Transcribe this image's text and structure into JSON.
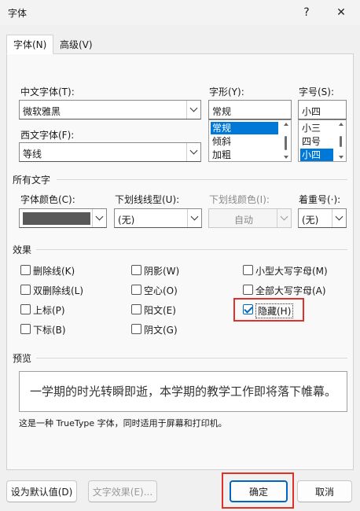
{
  "window": {
    "title": "字体",
    "help_icon": "?",
    "close_icon": "✕"
  },
  "tabs": [
    {
      "label": "字体(N)",
      "active": true
    },
    {
      "label": "高级(V)",
      "active": false
    }
  ],
  "fonts": {
    "chinese_label": "中文字体(T):",
    "chinese_value": "微软雅黑",
    "western_label": "西文字体(F):",
    "western_value": "等线",
    "style_label": "字形(Y):",
    "style_value": "常规",
    "style_options": [
      "常规",
      "倾斜",
      "加粗"
    ],
    "size_label": "字号(S):",
    "size_value": "小四",
    "size_options": [
      "小三",
      "四号",
      "小四"
    ]
  },
  "all_text": {
    "section_label": "所有文字",
    "color_label": "字体颜色(C):",
    "underline_style_label": "下划线线型(U):",
    "underline_style_value": "(无)",
    "underline_color_label": "下划线颜色(I):",
    "underline_color_value": "自动",
    "emphasis_label": "着重号(·):",
    "emphasis_value": "(无)"
  },
  "effects": {
    "section_label": "效果",
    "items": [
      {
        "label": "删除线(K)",
        "checked": false
      },
      {
        "label": "双删除线(L)",
        "checked": false
      },
      {
        "label": "上标(P)",
        "checked": false
      },
      {
        "label": "下标(B)",
        "checked": false
      },
      {
        "label": "阴影(W)",
        "checked": false
      },
      {
        "label": "空心(O)",
        "checked": false
      },
      {
        "label": "阳文(E)",
        "checked": false
      },
      {
        "label": "阴文(G)",
        "checked": false
      },
      {
        "label": "小型大写字母(M)",
        "checked": false
      },
      {
        "label": "全部大写字母(A)",
        "checked": false
      },
      {
        "label": "隐藏(H)",
        "checked": true
      }
    ]
  },
  "preview": {
    "section_label": "预览",
    "sample_text": "一学期的时光转瞬即逝，本学期的教学工作即将落下帷幕。",
    "note": "这是一种 TrueType 字体，同时适用于屏幕和打印机。"
  },
  "buttons": {
    "set_default": "设为默认值(D)",
    "text_effects": "文字效果(E)...",
    "ok": "确定",
    "cancel": "取消"
  },
  "colors": {
    "font_color_swatch": "#595959",
    "highlight": "#e0302a",
    "accent": "#0067c0"
  }
}
